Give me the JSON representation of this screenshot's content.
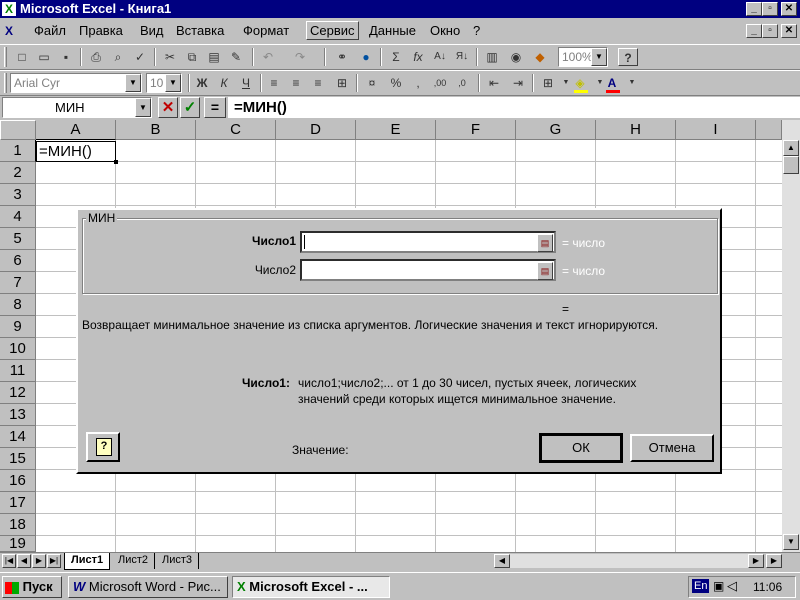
{
  "window": {
    "title": "Microsoft Excel - Книга1",
    "controls": [
      "_",
      "▫",
      "✕"
    ],
    "child_controls": [
      "_",
      "▫",
      "✕"
    ]
  },
  "menu": [
    "Файл",
    "Правка",
    "Вид",
    "Вставка",
    "Формат",
    "Сервис",
    "Данные",
    "Окно",
    "?"
  ],
  "toolbar": {
    "zoom": "100%",
    "font_name": "Arial Cyr",
    "font_size": "10",
    "bold": "Ж",
    "italic": "К",
    "underline": "Ч",
    "percent": "%",
    "comma": ",",
    "sigma": "Σ",
    "fx": "fx"
  },
  "formula_bar": {
    "name_box": "МИН",
    "equals": "=",
    "content": "=МИН()"
  },
  "grid": {
    "columns": [
      "A",
      "B",
      "C",
      "D",
      "E",
      "F",
      "G",
      "H",
      "I"
    ],
    "rows": [
      "1",
      "2",
      "3",
      "4",
      "5",
      "6",
      "7",
      "8",
      "9",
      "10",
      "11",
      "12",
      "13",
      "14",
      "15",
      "16",
      "17",
      "18",
      "19"
    ],
    "cell_a1": "=МИН()"
  },
  "sheet_tabs": [
    "Лист1",
    "Лист2",
    "Лист3"
  ],
  "dialog": {
    "group_title": "МИН",
    "arg1_label": "Число1",
    "arg2_label": "Число2",
    "arg1_result": "= число",
    "arg2_result": "= число",
    "formula_result": "=",
    "description": "Возвращает минимальное значение из списка аргументов. Логические значения и текст игнорируются.",
    "arg_help_label": "Число1:",
    "arg_help_line1": "число1;число2;... от 1 до 30 чисел, пустых ячеек, логических",
    "arg_help_line2": "значений среди которых ищется минимальное значение.",
    "value_label": "Значение:",
    "ok_label": "ОК",
    "cancel_label": "Отмена",
    "help_icon": "?"
  },
  "taskbar": {
    "start": "Пуск",
    "tasks": [
      "Microsoft Word - Рис...",
      "Microsoft Excel - ..."
    ],
    "lang": "En",
    "clock": "11:06"
  },
  "colors": {
    "titlebar": "#000080",
    "face": "#c0c0c0",
    "hint_text": "#ffffff"
  }
}
